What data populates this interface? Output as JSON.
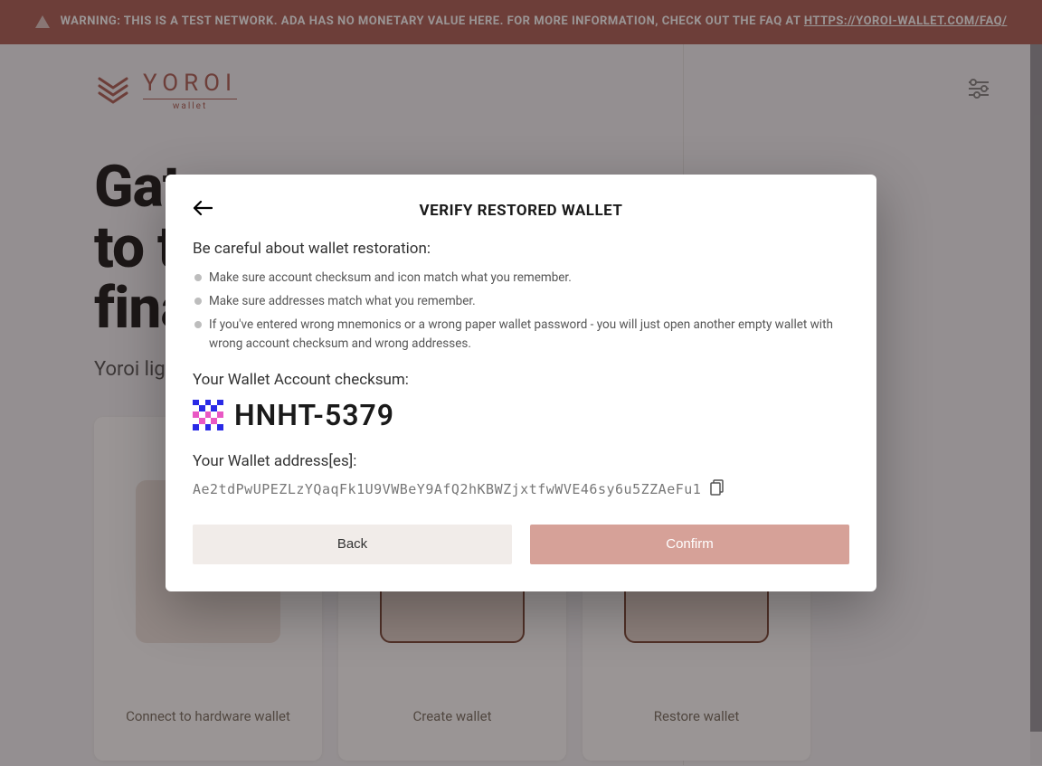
{
  "warning": {
    "prefix": "WARNING: THIS IS A TEST NETWORK. ADA HAS NO MONETARY VALUE HERE. FOR MORE INFORMATION, CHECK OUT THE FAQ AT ",
    "link": "HTTPS://YOROI-WALLET.COM/FAQ/"
  },
  "logo": {
    "word": "YOROI",
    "sub": "wallet"
  },
  "hero": {
    "line1": "Gateway",
    "line2": "to the",
    "line3": "financial world",
    "sub": "Yoroi light wallet for Cardano assets"
  },
  "cards": [
    {
      "label": "Connect to hardware wallet"
    },
    {
      "label": "Create wallet"
    },
    {
      "label": "Restore wallet"
    }
  ],
  "modal": {
    "title": "VERIFY RESTORED WALLET",
    "warn": "Be careful about wallet restoration:",
    "bullets": [
      "Make sure account checksum and icon match what you remember.",
      "Make sure addresses match what you remember.",
      "If you've entered wrong mnemonics or a wrong paper wallet password - you will just open another empty wallet with wrong account checksum and wrong addresses."
    ],
    "checksum_label": "Your Wallet Account checksum:",
    "checksum": "HNHT-5379",
    "address_label": "Your Wallet address[es]:",
    "address": "Ae2tdPwUPEZLzYQaqFk1U9VWBeY9AfQ2hKBWZjxtfwWVE46sy6u5ZZAeFu1",
    "back": "Back",
    "confirm": "Confirm"
  },
  "identicon_colors": {
    "a": "#2a2ae6",
    "b": "#ffffff",
    "c": "#e958c4",
    "pattern": [
      "a",
      "b",
      "a",
      "b",
      "a",
      "b",
      "a",
      "b",
      "a",
      "b",
      "c",
      "b",
      "c",
      "b",
      "c",
      "b",
      "c",
      "b",
      "c",
      "b",
      "a",
      "b",
      "a",
      "b",
      "a"
    ]
  }
}
